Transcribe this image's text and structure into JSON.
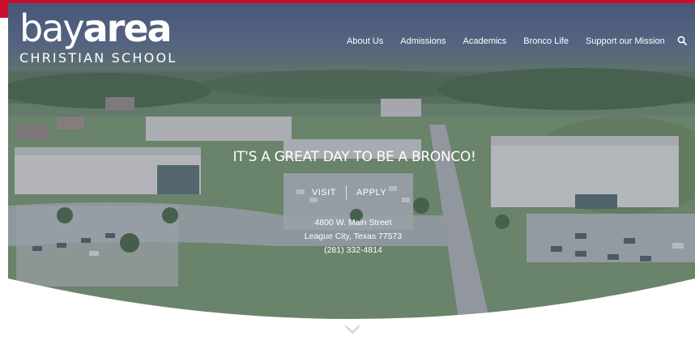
{
  "logo": {
    "word_light": "bay",
    "word_bold": "area",
    "subtitle": "CHRISTIAN SCHOOL"
  },
  "nav": {
    "items": [
      "About Us",
      "Admissions",
      "Academics",
      "Bronco Life",
      "Support our Mission"
    ]
  },
  "hero": {
    "headline": "IT'S A GREAT DAY TO BE A BRONCO!",
    "buttons": [
      "VISIT",
      "APPLY"
    ],
    "address": [
      "4800 W. Main Street",
      "League City, Texas 77573",
      "(281) 332-4814"
    ]
  },
  "colors": {
    "accent": "#c8102e",
    "text": "#ffffff",
    "overlay": "#374669"
  },
  "icons": {
    "search": "search-icon",
    "scroll": "chevron-down-icon"
  }
}
